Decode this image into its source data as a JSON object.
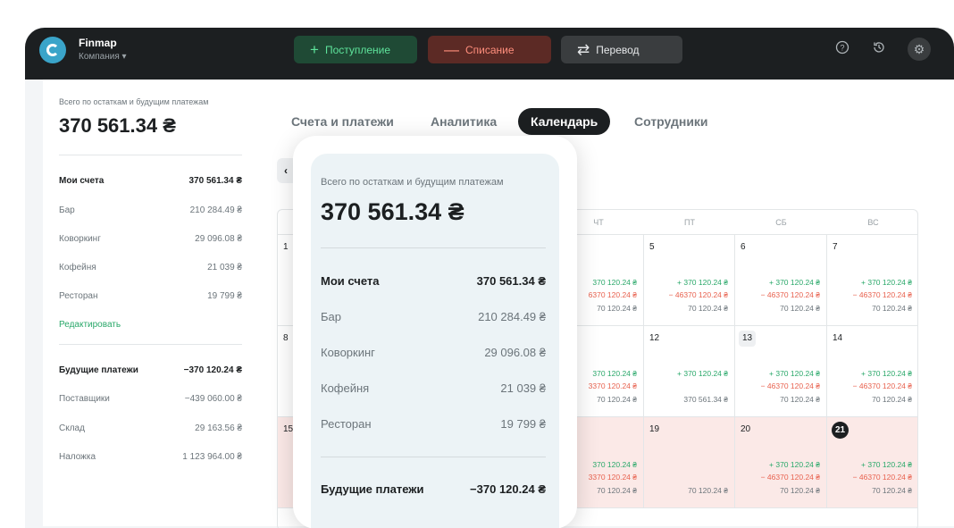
{
  "app": {
    "name": "Finmap",
    "company": "Компания ▾"
  },
  "toolbar": {
    "income": "Поступление",
    "expense": "Списание",
    "transfer": "Перевод",
    "income_icon": "plus-icon",
    "expense_icon": "minus-icon",
    "transfer_icon": "swap-icon",
    "help_icon": "help-icon",
    "history_icon": "history-icon",
    "settings_icon": "gear-icon"
  },
  "sidebar": {
    "total_label": "Всего по остаткам и будущим платежам",
    "total_value": "370 561.34 ₴",
    "accounts_header": {
      "label": "Мои счета",
      "value": "370 561.34 ₴"
    },
    "accounts": [
      {
        "label": "Бар",
        "value": "210 284.49 ₴"
      },
      {
        "label": "Коворкинг",
        "value": "29 096.08 ₴"
      },
      {
        "label": "Кофейня",
        "value": "21 039 ₴"
      },
      {
        "label": "Ресторан",
        "value": "19 799 ₴"
      }
    ],
    "edit_link": "Редактировать",
    "future_header": {
      "label": "Будущие платежи",
      "value": "−370 120.24 ₴"
    },
    "future": [
      {
        "label": "Поставщики",
        "value": "−439 060.00 ₴"
      },
      {
        "label": "Склад",
        "value": "29 163.56 ₴"
      },
      {
        "label": "Наложка",
        "value": "1 123 964.00 ₴"
      }
    ]
  },
  "tabs": [
    "Счета и платежи",
    "Аналитика",
    "Календарь",
    "Сотрудники"
  ],
  "active_tab": "Календарь",
  "back_label": "‹",
  "calendar": {
    "day_headers": [
      "ЧТ",
      "ПТ",
      "СБ",
      "ВС"
    ],
    "rows": [
      {
        "left_day": "1",
        "days": [
          {
            "num": "",
            "green": "370 120.24 ₴",
            "red": "6370 120.24 ₴",
            "neutral": "70 120.24 ₴"
          },
          {
            "num": "5",
            "green": "+ 370 120.24 ₴",
            "red": "− 46370 120.24 ₴",
            "neutral": "70 120.24 ₴"
          },
          {
            "num": "6",
            "green": "+ 370 120.24 ₴",
            "red": "− 46370 120.24 ₴",
            "neutral": "70 120.24 ₴"
          },
          {
            "num": "7",
            "green": "+ 370 120.24 ₴",
            "red": "− 46370 120.24 ₴",
            "neutral": "70 120.24 ₴"
          }
        ]
      },
      {
        "left_day": "8",
        "days": [
          {
            "num": "",
            "green": "370 120.24 ₴",
            "red": "3370 120.24 ₴",
            "neutral": "70 120.24 ₴"
          },
          {
            "num": "12",
            "green": "+ 370 120.24 ₴",
            "red": "",
            "neutral": "370 561.34 ₴"
          },
          {
            "num": "13",
            "green": "+ 370 120.24 ₴",
            "red": "− 46370 120.24 ₴",
            "neutral": "70 120.24 ₴"
          },
          {
            "num": "14",
            "green": "+ 370 120.24 ₴",
            "red": "− 46370 120.24 ₴",
            "neutral": "70 120.24 ₴"
          }
        ]
      },
      {
        "left_day": "15",
        "days": [
          {
            "num": "",
            "green": "370 120.24 ₴",
            "red": "3370 120.24 ₴",
            "neutral": "70 120.24 ₴"
          },
          {
            "num": "19",
            "green": "",
            "red": "",
            "neutral": "70 120.24 ₴"
          },
          {
            "num": "20",
            "green": "+ 370 120.24 ₴",
            "red": "− 46370 120.24 ₴",
            "neutral": "70 120.24 ₴"
          },
          {
            "num": "21",
            "green": "+ 370 120.24 ₴",
            "red": "− 46370 120.24 ₴",
            "neutral": "70 120.24 ₴"
          }
        ]
      }
    ]
  },
  "popup": {
    "total_label": "Всего по остаткам и будущим платежам",
    "total_value": "370 561.34 ₴",
    "accounts_header": {
      "label": "Мои счета",
      "value": "370 561.34 ₴"
    },
    "accounts": [
      {
        "label": "Бар",
        "value": "210 284.49 ₴"
      },
      {
        "label": "Коворкинг",
        "value": "29 096.08 ₴"
      },
      {
        "label": "Кофейня",
        "value": "21 039 ₴"
      },
      {
        "label": "Ресторан",
        "value": "19 799 ₴"
      }
    ],
    "future_header": {
      "label": "Будущие платежи",
      "value": "−370 120.24 ₴"
    }
  },
  "colors": {
    "income": "#5ee39b",
    "expense": "#ff8e7c",
    "positive": "#2aa86a",
    "negative": "#e8624f",
    "highlight_row": "#fbe9e7"
  }
}
